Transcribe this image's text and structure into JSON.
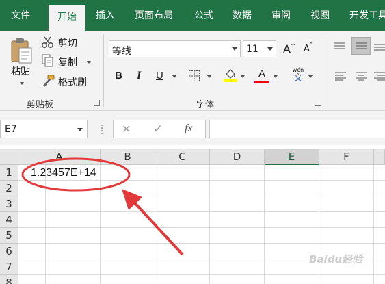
{
  "tabs": [
    "文件",
    "开始",
    "插入",
    "页面布局",
    "公式",
    "数据",
    "审阅",
    "视图",
    "开发工具"
  ],
  "clipboard": {
    "paste_label": "粘贴",
    "cut_label": "剪切",
    "copy_label": "复制",
    "format_painter_label": "格式刷",
    "group_label": "剪贴板"
  },
  "font": {
    "font_name": "等线",
    "font_size": "11",
    "bold": "B",
    "italic": "I",
    "underline": "U",
    "font_color_letter": "A",
    "grow_letter": "A",
    "shrink_letter": "A",
    "phonetic_top": "wén",
    "phonetic_char": "文",
    "group_label": "字体"
  },
  "formula_bar": {
    "name_box": "E7",
    "cancel_symbol": "✕",
    "enter_symbol": "✓",
    "fx_label": "fx",
    "formula": ""
  },
  "sheet": {
    "columns": [
      "A",
      "B",
      "C",
      "D",
      "E",
      "F"
    ],
    "rows": [
      "1",
      "2",
      "3",
      "4",
      "5",
      "6",
      "7",
      "8"
    ],
    "cell_a1": "1.23457E+14"
  },
  "watermark": "Baidu经验",
  "colors": {
    "ribbon_green": "#217346",
    "annotation_red": "#e23a3a",
    "highlight_yellow": "#ffff00",
    "font_red": "#ff0000"
  }
}
